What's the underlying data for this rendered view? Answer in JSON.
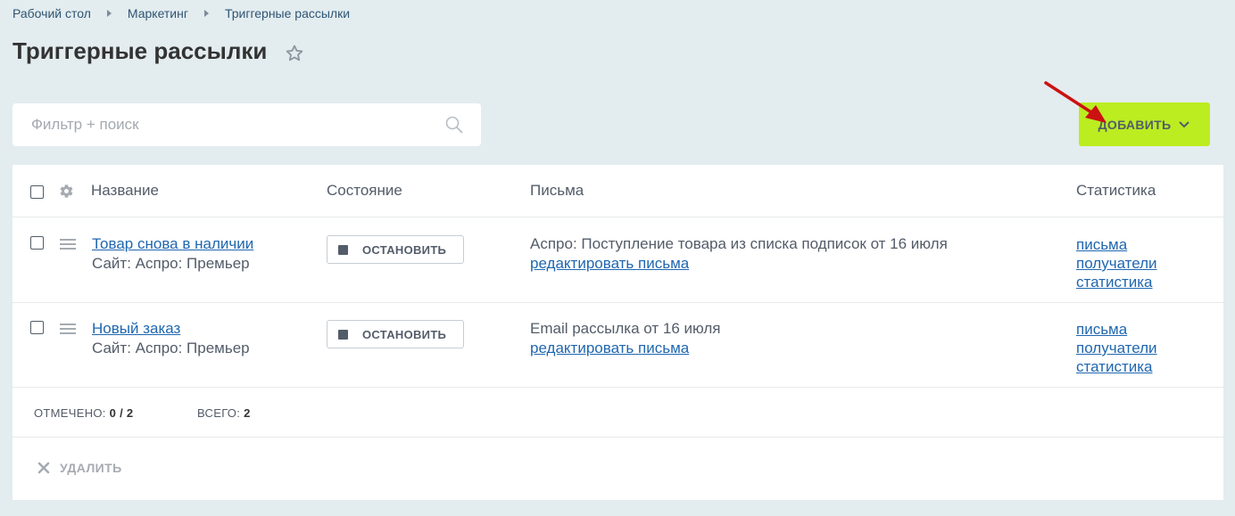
{
  "breadcrumb": [
    "Рабочий стол",
    "Маркетинг",
    "Триггерные рассылки"
  ],
  "page": {
    "title": "Триггерные рассылки"
  },
  "search": {
    "placeholder": "Фильтр + поиск",
    "value": ""
  },
  "toolbar": {
    "add_label": "ДОБАВИТЬ"
  },
  "table": {
    "columns": [
      "Название",
      "Состояние",
      "Письма",
      "Статистика"
    ],
    "rows": [
      {
        "title": "Товар снова в наличии",
        "site": "Сайт: Аспро: Премьер",
        "action": "ОСТАНОВИТЬ",
        "letter": "Аспро: Поступление товара из списка подписок от 16 июля",
        "edit": "редактировать письма",
        "stats": [
          "письма",
          "получатели",
          "статистика"
        ]
      },
      {
        "title": "Новый заказ",
        "site": "Сайт: Аспро: Премьер",
        "action": "ОСТАНОВИТЬ",
        "letter": "Email рассылка от 16 июля",
        "edit": "редактировать письма",
        "stats": [
          "письма",
          "получатели",
          "статистика"
        ]
      }
    ]
  },
  "footer": {
    "selected_label": "ОТМЕЧЕНО:",
    "selected_value": "0 / 2",
    "total_label": "ВСЕГО:",
    "total_value": "2",
    "delete_label": "УДАЛИТЬ"
  },
  "icons": {
    "star": "star-icon",
    "search": "search-icon",
    "gear": "gear-icon",
    "drag": "drag-handle-icon",
    "close": "close-icon",
    "chevron": "chevron-down-icon"
  },
  "colors": {
    "accent": "#bbed21",
    "link": "#2067b0",
    "background": "#e3ecef",
    "annotation": "#cc1111"
  }
}
